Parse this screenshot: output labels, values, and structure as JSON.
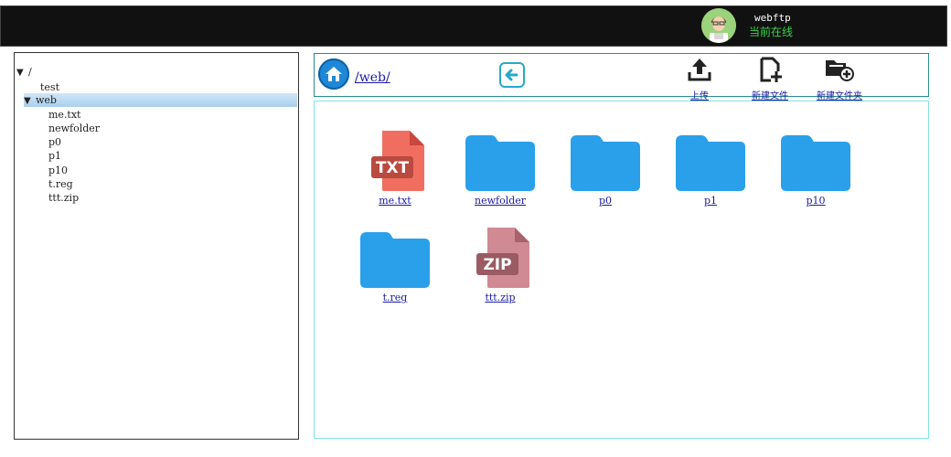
{
  "header": {
    "username": "webftp",
    "status": "当前在线"
  },
  "tree": {
    "root": "/",
    "items": [
      {
        "label": "test",
        "expanded": false,
        "selected": false
      },
      {
        "label": "web",
        "expanded": true,
        "selected": true
      }
    ],
    "web_children": [
      "me.txt",
      "newfolder",
      "p0",
      "p1",
      "p10",
      "t.reg",
      "ttt.zip"
    ]
  },
  "toolbar": {
    "path": "/web/",
    "upload_label": "上传",
    "new_file_label": "新建文件",
    "new_folder_label": "新建文件夹"
  },
  "files": [
    {
      "name": "me.txt",
      "type": "txt",
      "badge": "TXT"
    },
    {
      "name": "newfolder",
      "type": "folder"
    },
    {
      "name": "p0",
      "type": "folder"
    },
    {
      "name": "p1",
      "type": "folder"
    },
    {
      "name": "p10",
      "type": "folder"
    },
    {
      "name": "t.reg",
      "type": "folder"
    },
    {
      "name": "ttt.zip",
      "type": "zip",
      "badge": "ZIP"
    }
  ],
  "colors": {
    "folder": "#2aa0ea",
    "txt": "#f06e60",
    "zip": "#d08a94",
    "link": "#1a1aa6",
    "online": "#3bd24a"
  }
}
